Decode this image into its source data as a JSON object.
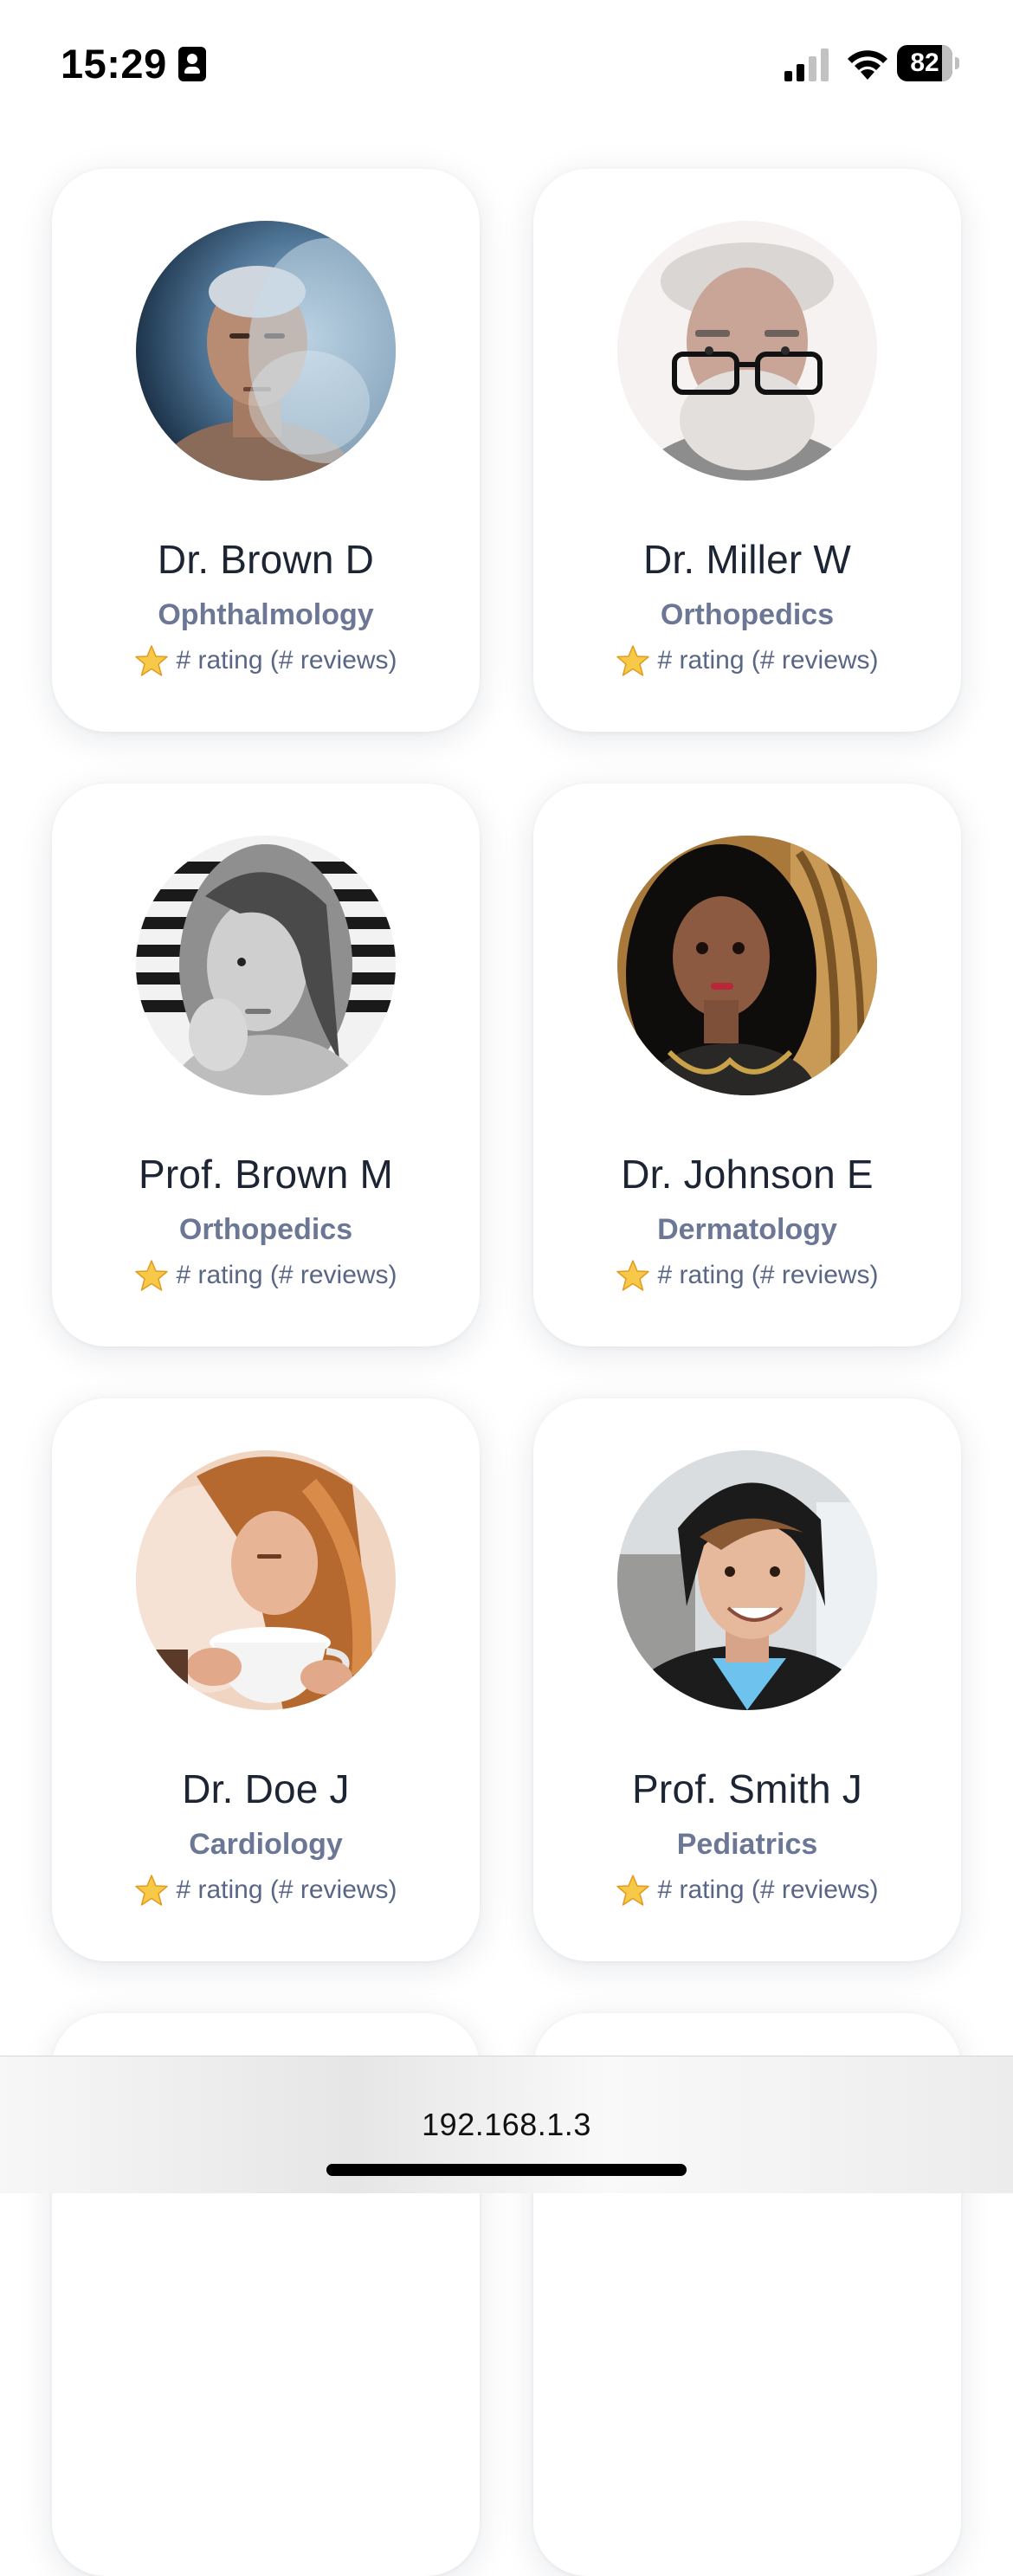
{
  "status_bar": {
    "time": "15:29",
    "battery_level": 82,
    "battery_label": "82"
  },
  "doctors": [
    {
      "name": "Dr. Brown D",
      "specialty": "Ophthalmology",
      "rating": "# rating (# reviews)",
      "avatar": "man-shaved-head-smoke"
    },
    {
      "name": "Dr. Miller W",
      "specialty": "Orthopedics",
      "rating": "# rating (# reviews)",
      "avatar": "old-man-glasses-beard"
    },
    {
      "name": "Prof. Brown M",
      "specialty": "Orthopedics",
      "rating": "# rating (# reviews)",
      "avatar": "woman-bw-portrait"
    },
    {
      "name": "Dr. Johnson E",
      "specialty": "Dermatology",
      "rating": "# rating (# reviews)",
      "avatar": "girl-dark-hair"
    },
    {
      "name": "Dr. Doe J",
      "specialty": "Cardiology",
      "rating": "# rating (# reviews)",
      "avatar": "woman-drinking-coffee"
    },
    {
      "name": "Prof. Smith J",
      "specialty": "Pediatrics",
      "rating": "# rating (# reviews)",
      "avatar": "young-man-beanie"
    }
  ],
  "browser": {
    "address": "192.168.1.3"
  },
  "colors": {
    "card_bg": "#ffffff",
    "name_text": "#1d2433",
    "specialty_text": "#6c7796",
    "rating_text": "#5a6685",
    "star": "#f7c948"
  }
}
